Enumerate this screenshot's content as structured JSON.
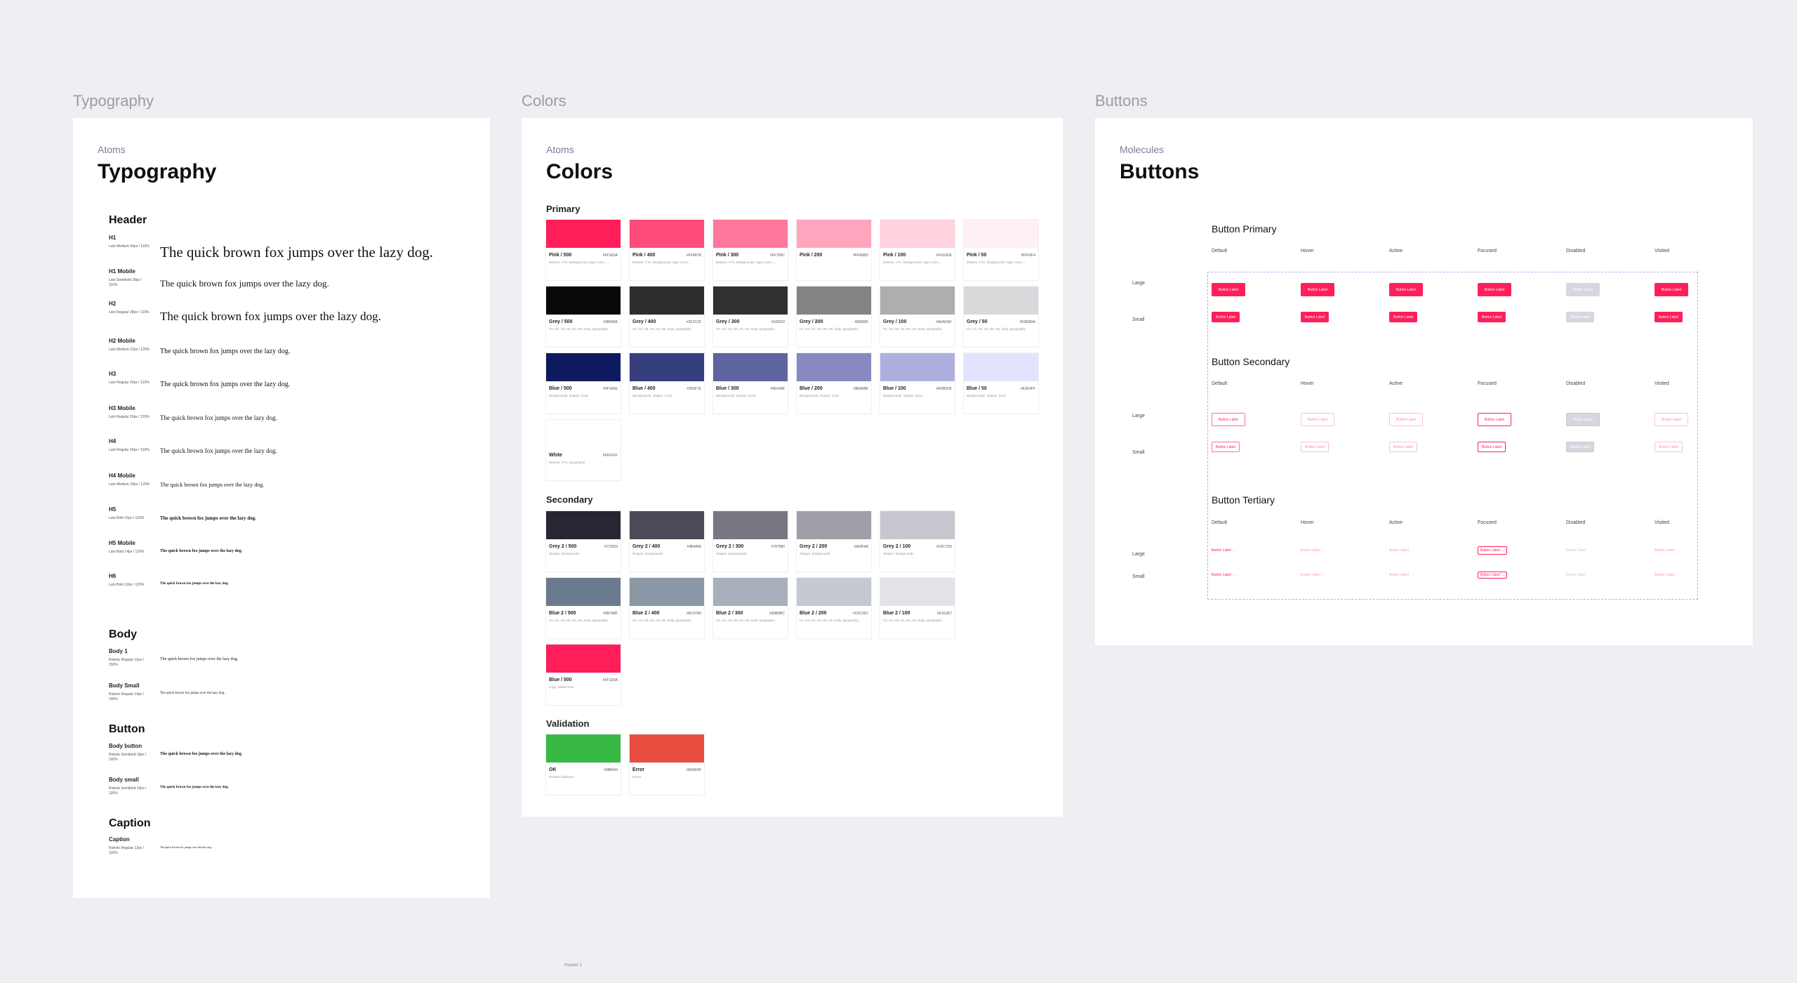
{
  "frames": {
    "typography": {
      "label": "Typography",
      "crumb": "Atoms",
      "title": "Typography"
    },
    "colors": {
      "label": "Colors",
      "crumb": "Atoms",
      "title": "Colors"
    },
    "buttons": {
      "label": "Buttons",
      "crumb": "Molecules",
      "title": "Buttons"
    }
  },
  "typography": {
    "sections": [
      "Header",
      "Body",
      "Button",
      "Caption"
    ],
    "sample": "The quick brown fox jumps over the lazy dog.",
    "rows": [
      {
        "name": "H1",
        "meta": "Lato Medium 36px / 110%"
      },
      {
        "name": "H1 Mobile",
        "meta": "Lato Semibold 28px / 110%"
      },
      {
        "name": "H2",
        "meta": "Lato Regular 28px / 110%"
      },
      {
        "name": "H2 Mobile",
        "meta": "Lato Medium 22px / 120%"
      },
      {
        "name": "H3",
        "meta": "Lato Regular 24px / 120%"
      },
      {
        "name": "H3 Mobile",
        "meta": "Lato Regular 20px / 120%"
      },
      {
        "name": "H4",
        "meta": "Lato Regular 20px / 120%"
      },
      {
        "name": "H4 Mobile",
        "meta": "Lato Medium 18px / 120%"
      },
      {
        "name": "H5",
        "meta": "Lato Bold 16px / 120%"
      },
      {
        "name": "H5 Mobile",
        "meta": "Lato Bold 14px / 120%"
      },
      {
        "name": "H6",
        "meta": "Lato Bold 12px / 120%"
      },
      {
        "name": "Body 1",
        "meta": "Roboto Regular 16px / 150%"
      },
      {
        "name": "Body Small",
        "meta": "Roboto Regular 14px / 140%"
      },
      {
        "name": "Body button",
        "meta": "Roboto Semibold 16px / 100%"
      },
      {
        "name": "Body small",
        "meta": "Roboto Semibold 14px / 100%"
      },
      {
        "name": "Caption",
        "meta": "Roboto Regular 12px / 120%"
      }
    ]
  },
  "colors": {
    "sections": [
      "Primary",
      "Secondary",
      "Validation"
    ],
    "primary": [
      {
        "name": "Pink / 500",
        "hex": "#FF1E5A",
        "color": "#ff1e5a",
        "desc": "Buttons, CTA, backgrounds, tags, icons, ..."
      },
      {
        "name": "Pink / 400",
        "hex": "#FF4B7B",
        "color": "#ff4b7b",
        "desc": "Buttons, CTA, backgrounds, tags, icons, ..."
      },
      {
        "name": "Pink / 300",
        "hex": "#FF789C",
        "color": "#ff789c",
        "desc": "Buttons, CTA, backgrounds, tags, icons, ..."
      },
      {
        "name": "Pink / 200",
        "hex": "#FFA5BD",
        "color": "#ffa5bd",
        "desc": ""
      },
      {
        "name": "Pink / 100",
        "hex": "#FFD2DE",
        "color": "#ffd2de",
        "desc": "Buttons, CTA, backgrounds, tags, icons, ..."
      },
      {
        "name": "Pink / 50",
        "hex": "#FFF0F4",
        "color": "#fff0f4",
        "desc": "Buttons, CTA, backgrounds, tags, icons, ..."
      },
      {
        "name": "Grey / 500",
        "hex": "#0B080A",
        "color": "#0b080a",
        "desc": "H1, H2, H3, H4, H5, H6, body, typography"
      },
      {
        "name": "Grey / 400",
        "hex": "#2E2C2F",
        "color": "#2e2c2f",
        "desc": "H1, H2, H3, H4, H5, H6, body, typography"
      },
      {
        "name": "Grey / 300",
        "hex": "#333033",
        "color": "#333033",
        "desc": "H1, H2, H3, H4, H5, H6, body, typography"
      },
      {
        "name": "Grey / 200",
        "hex": "#858385",
        "color": "#858385",
        "desc": "H1, H2, H3, H4, H5, H6, body, typography"
      },
      {
        "name": "Grey / 100",
        "hex": "#AEADAF",
        "color": "#aeadaf",
        "desc": "H1, H2, H3, H4, H5, H6, body, typography"
      },
      {
        "name": "Grey / 50",
        "hex": "#D9D8DA",
        "color": "#d9d8da",
        "desc": "H1, H2, H3, H4, H5, H6, body, typography"
      },
      {
        "name": "Blue / 500",
        "hex": "#0F1A5E",
        "color": "#0f1a5e",
        "desc": "Backgrounds, shapes, icons"
      },
      {
        "name": "Blue / 400",
        "hex": "#363E7E",
        "color": "#363e7e",
        "desc": "Backgrounds, shapes, icons"
      },
      {
        "name": "Blue / 300",
        "hex": "#5E649E",
        "color": "#5e649e",
        "desc": "Backgrounds, shapes, icons"
      },
      {
        "name": "Blue / 200",
        "hex": "#868ABE",
        "color": "#868abe",
        "desc": "Backgrounds, shapes, icons"
      },
      {
        "name": "Blue / 100",
        "hex": "#ADB0DE",
        "color": "#adb0de",
        "desc": "Backgrounds, shapes, icons"
      },
      {
        "name": "Blue / 50",
        "hex": "#E2E4FF",
        "color": "#e2e4ff",
        "desc": "Backgrounds, shapes, icons"
      },
      {
        "name": "White",
        "hex": "#FFFFFF",
        "color": "#ffffff",
        "desc": "Buttons, CTA, typography"
      }
    ],
    "secondary": [
      {
        "name": "Grey 2 / 500",
        "hex": "#272633",
        "color": "#272633",
        "desc": "Shapes, backgrounds"
      },
      {
        "name": "Grey 2 / 400",
        "hex": "#4B4A58",
        "color": "#4b4a58",
        "desc": "Shapes, backgrounds"
      },
      {
        "name": "Grey 2 / 300",
        "hex": "#787680",
        "color": "#787680",
        "desc": "Shapes, backgrounds"
      },
      {
        "name": "Grey 2 / 200",
        "hex": "#A09FA8",
        "color": "#a09fa8",
        "desc": "Shapes, backgrounds"
      },
      {
        "name": "Grey 2 / 100",
        "hex": "#C8C7D0",
        "color": "#c8c7d0",
        "desc": "Shapes, backgrounds"
      },
      {
        "name": "Blue 2 / 500",
        "hex": "#6B7A8F",
        "color": "#6b7a8f",
        "desc": "H1, H2, H3, H4, H5, H6, body, typography"
      },
      {
        "name": "Blue 2 / 400",
        "hex": "#8C97A6",
        "color": "#8c97a6",
        "desc": "H1, H2, H3, H4, H5, H6, body, typography"
      },
      {
        "name": "Blue 2 / 300",
        "hex": "#A9B0BC",
        "color": "#a9b0bc",
        "desc": "H1, H2, H3, H4, H5, H6, body, typography"
      },
      {
        "name": "Blue 2 / 200",
        "hex": "#C5C9D1",
        "color": "#c5c9d1",
        "desc": "H1, H2, H3, H4, H5, H6, body, typography"
      },
      {
        "name": "Blue 2 / 100",
        "hex": "#E1E3E7",
        "color": "#e1e3e7",
        "desc": "H1, H2, H3, H4, H5, H6, body, typography"
      },
      {
        "name": "Blue / 500",
        "hex": "#FF1E5A",
        "color": "#ff1e5a",
        "desc": "Logo, visible lines"
      }
    ],
    "validation": [
      {
        "name": "OK",
        "hex": "#38B944",
        "color": "#38b944",
        "desc": "Positive validation"
      },
      {
        "name": "Error",
        "hex": "#E84D40",
        "color": "#e84d40",
        "desc": "Errors"
      }
    ]
  },
  "buttons": {
    "groups": [
      "Button Primary",
      "Button Secondary",
      "Button Tertiary"
    ],
    "states": [
      "Default",
      "Hover",
      "Active",
      "Focused",
      "Disabled",
      "Visited"
    ],
    "sizes": [
      "Large",
      "Small"
    ],
    "label": "Button Label",
    "tertiary_label": "Button Label  →"
  },
  "footer": "Header  1"
}
